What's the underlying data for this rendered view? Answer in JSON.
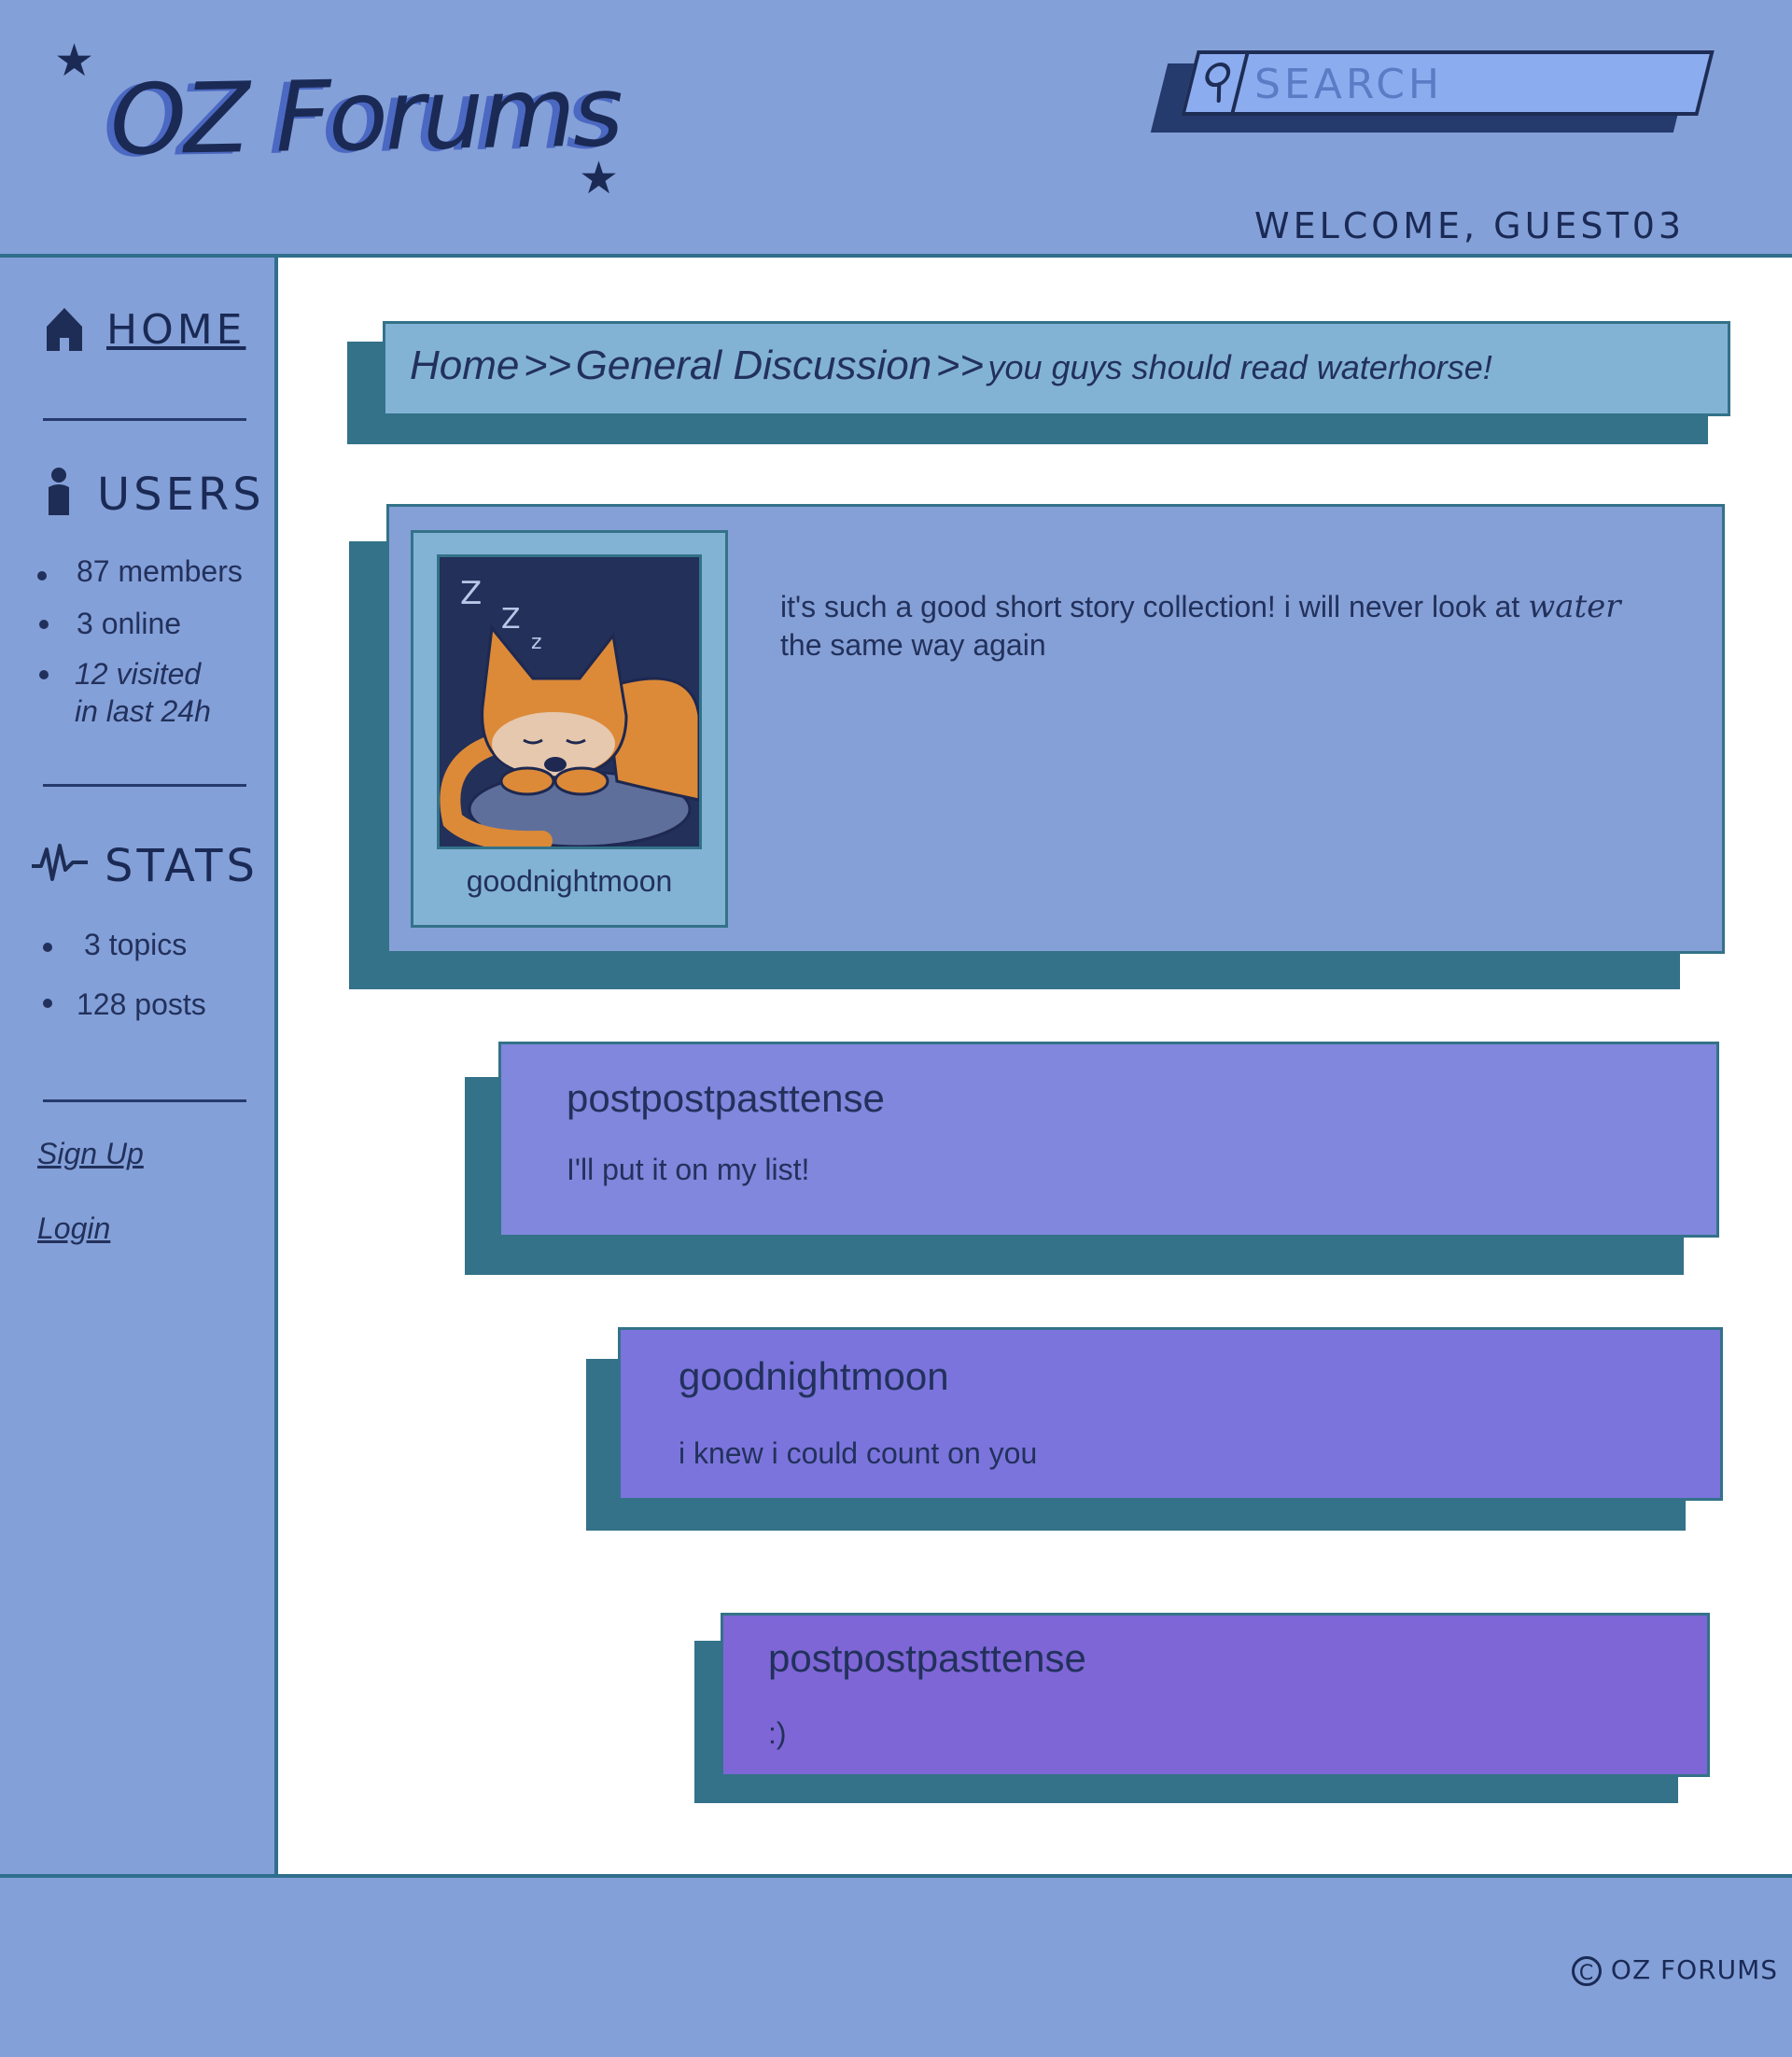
{
  "app": {
    "logo_text": "OZ Forums",
    "welcome": "WELCOME, GUEST03"
  },
  "search": {
    "placeholder": "SEARCH",
    "value": ""
  },
  "sidebar": {
    "home_label": "HOME",
    "users_heading": "USERS",
    "users_items": [
      "87 members",
      "3 online",
      "12 visited",
      "in last 24h"
    ],
    "stats_heading": "STATS",
    "stats_items": [
      "3 topics",
      "128 posts"
    ],
    "signup_label": "Sign Up",
    "login_label": "Login"
  },
  "breadcrumb": {
    "home": "Home",
    "sep": ">>",
    "category": "General Discussion",
    "thread": "you guys should read waterhorse!"
  },
  "posts": [
    {
      "author": "goodnightmoon",
      "body_1": "it's such a good short story collection! i will never look at",
      "body_emph": "water",
      "body_2": "the same way again"
    },
    {
      "author": "postpostpasttense",
      "body": "I'll put it on my list!"
    },
    {
      "author": "goodnightmoon",
      "body": "i knew i could count on you"
    },
    {
      "author": "postpostpasttense",
      "body": ":)"
    }
  ],
  "colors": {
    "header_bg": "#84a0d8",
    "main_bg": "#ffffff",
    "shadow": "#337289",
    "breadcrumb_bg": "#83b3d4",
    "reply1_bg": "#8087dc",
    "reply2_bg": "#7b74dc",
    "reply3_bg": "#7e66d6"
  },
  "icons": {
    "home": "home-icon",
    "users": "user-icon",
    "stats": "pulse-icon",
    "search": "search-icon",
    "copyright": "copyright-icon"
  },
  "footer": {
    "copyright_symbol": "©",
    "copyright_text": "OZ FORUMS"
  }
}
